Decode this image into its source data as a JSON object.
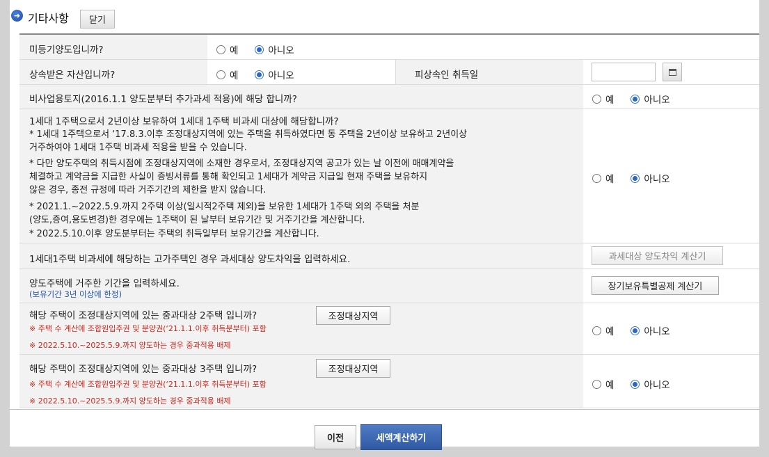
{
  "header": {
    "title": "기타사항",
    "close_label": "닫기"
  },
  "radio": {
    "yes": "예",
    "no": "아니오"
  },
  "rows": {
    "unregistered": {
      "question": "미등기양도입니까?",
      "selected": "no"
    },
    "inherited": {
      "question": "상속받은 자산입니까?",
      "selected": "no",
      "acq_label": "피상속인 취득일",
      "acq_value": ""
    },
    "nonbusiness": {
      "question": "비사업용토지(2016.1.1 양도분부터 추가과세 적용)에 해당 합니까?",
      "selected": "no"
    },
    "one_house": {
      "question": "1세대 1주택으로서 2년이상 보유하여 1세대 1주택 비과세 대상에 해당합니까?",
      "note1_l1": "* 1세대 1주택으로서 ‘17.8.3.이후 조정대상지역에 있는 주택을 취득하였다면 동 주택을 2년이상 보유하고 2년이상",
      "note1_l2": "거주하여야 1세대 1주택 비과세 적용을 받을 수 있습니다.",
      "note2_l1": "* 다만 양도주택의 취득시점에 조정대상지역에 소재한 경우로서, 조정대상지역 공고가 있는 날 이전에 매매계약을",
      "note2_l2": "체결하고 계약금을 지급한 사실이 증빙서류를 통해 확인되고 1세대가 계약금 지급일 현재 주택을 보유하지",
      "note2_l3": "않은 경우, 종전 규정에 따라 거주기간의 제한을 받지 않습니다.",
      "note3_l1": "* 2021.1.~2022.5.9.까지 2주택 이상(일시적2주택 제외)을 보유한 1세대가 1주택 외의 주택을 처분",
      "note3_l2": "(양도,증여,용도변경)한 경우에는 1주택이 된 날부터 보유기간 및 거주기간을 계산합니다.",
      "note4": "* 2022.5.10.이후 양도분부터는 주택의 취득일부터 보유기간을 계산합니다.",
      "selected": "no"
    },
    "luxury": {
      "question": "1세대1주택 비과세에 해당하는 고가주택인 경우 과세대상 양도차익을 입력하세요.",
      "button": "과세대상 양도차익 계산기"
    },
    "residence": {
      "question": "양도주택에 거주한 기간을 입력하세요.",
      "hint": "(보유기간 3년 이상에 한정)",
      "button": "장기보유특별공제 계산기"
    },
    "two_house": {
      "question": "해당 주택이 조정대상지역에 있는 중과대상 2주택 입니까?",
      "button": "조정대상지역",
      "red1": "※ 주택 수 계산에 조합원입주권 및 분양권(‘21.1.1.이후 취득분부터) 포함",
      "red2": "※ 2022.5.10.~2025.5.9.까지 양도하는 경우 중과적용 배제",
      "selected": "no"
    },
    "three_house": {
      "question": "해당 주택이 조정대상지역에 있는 중과대상 3주택 입니까?",
      "button": "조정대상지역",
      "red1": "※ 주택 수 계산에 조합원입주권 및 분양권(‘21.1.1.이후 취득분부터) 포함",
      "red2": "※ 2022.5.10.~2025.5.9.까지 양도하는 경우 중과적용 배제",
      "selected": "no"
    }
  },
  "footer": {
    "prev_label": "이전",
    "calc_label": "세액계산하기"
  }
}
